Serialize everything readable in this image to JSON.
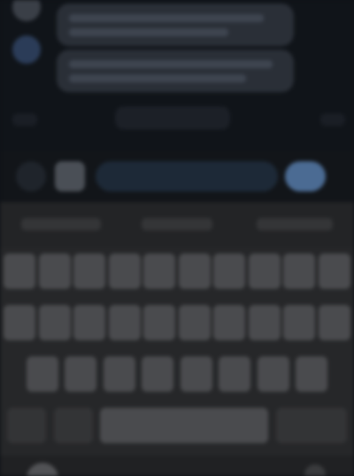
{
  "chat": {
    "messages": [
      {
        "sender": "other",
        "lines": 2
      },
      {
        "sender": "other",
        "lines": 2
      }
    ],
    "timestamp": ""
  },
  "composer": {
    "input_value": "",
    "input_placeholder": ""
  },
  "keyboard": {
    "suggestions": [
      "",
      "",
      ""
    ],
    "row1": [
      "",
      "",
      "",
      "",
      "",
      "",
      "",
      "",
      "",
      ""
    ],
    "row2": [
      "",
      "",
      "",
      "",
      "",
      "",
      "",
      "",
      "",
      ""
    ],
    "row3": [
      "",
      "",
      "",
      "",
      "",
      "",
      "",
      ""
    ],
    "row4": [
      "",
      "",
      "",
      ""
    ]
  },
  "icons": {
    "add": "plus-icon",
    "photo": "photo-icon",
    "send": "send-icon",
    "globe": "globe-icon",
    "mic": "mic-icon"
  },
  "colors": {
    "chat_background": "#101419",
    "bubble": "#2a2f37",
    "accent": "#4b6b93",
    "keyboard": "#262729",
    "key": "#4a4b4e"
  }
}
